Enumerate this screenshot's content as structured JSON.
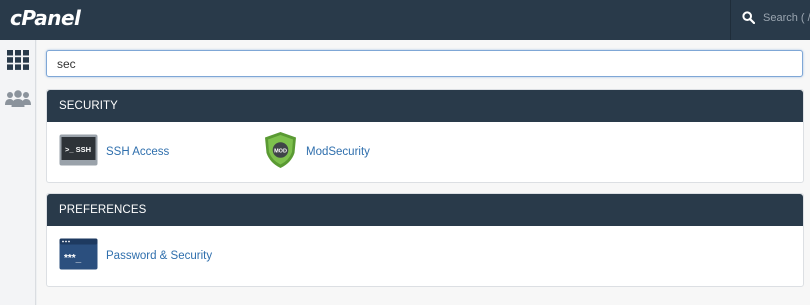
{
  "brand": {
    "logo_text": "cPanel"
  },
  "topbar": {
    "search_placeholder": "Search ( /"
  },
  "filter": {
    "value": "sec"
  },
  "sections": {
    "security": {
      "title": "SECURITY",
      "items": [
        {
          "label": "SSH Access",
          "icon": "terminal-icon",
          "icon_text": ">_ SSH"
        },
        {
          "label": "ModSecurity",
          "icon": "shield-icon",
          "icon_text": "MOD"
        }
      ]
    },
    "preferences": {
      "title": "PREFERENCES",
      "items": [
        {
          "label": "Password & Security",
          "icon": "password-icon",
          "icon_text": "***_"
        }
      ]
    }
  },
  "colors": {
    "header": "#293a4a",
    "link": "#2f6fad",
    "shield_green": "#6bb23e",
    "background": "#f7f7f7"
  }
}
